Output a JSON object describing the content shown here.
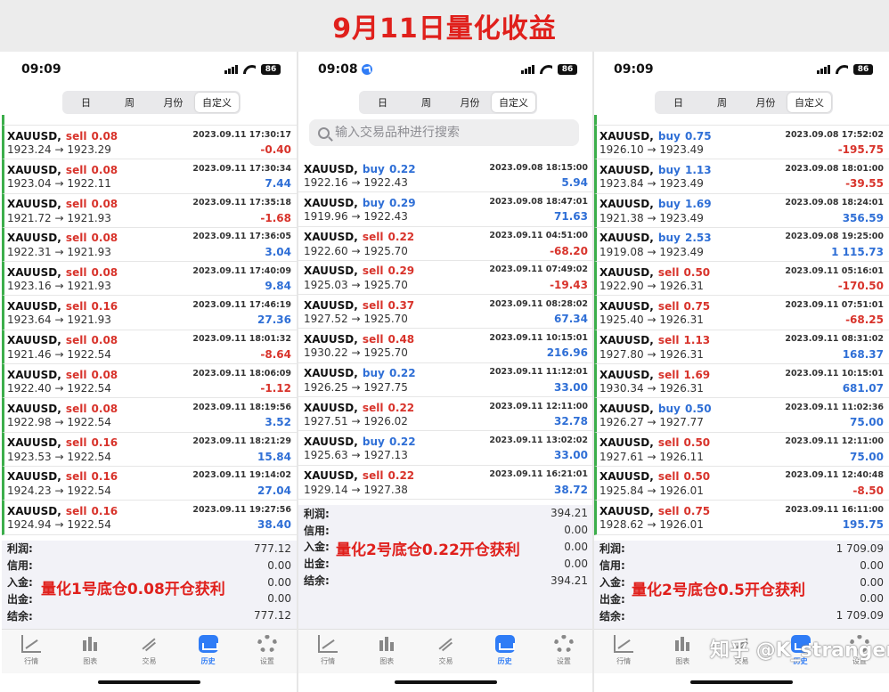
{
  "title": "9月11日量化收益",
  "status_bar": {
    "battery": "86"
  },
  "period_tabs": [
    "日",
    "周",
    "月份",
    "自定义"
  ],
  "active_tab": "自定义",
  "search_placeholder": "输入交易品种进行搜索",
  "nav": [
    "行情",
    "图表",
    "交易",
    "历史",
    "设置"
  ],
  "summary_labels": [
    "利润:",
    "信用:",
    "入金:",
    "出金:",
    "结余:"
  ],
  "watermark": "知乎 @K_stranger",
  "panels": [
    {
      "time": "09:09",
      "annotation": "量化1号底仓0.08开仓获利",
      "trades": [
        {
          "symbol": "XAUUSD,",
          "dir": "sell",
          "lot": "0.08",
          "datetime": "2023.09.11 17:30:17",
          "open": "1923.24",
          "close": "1923.29",
          "profit": "-0.40"
        },
        {
          "symbol": "XAUUSD,",
          "dir": "sell",
          "lot": "0.08",
          "datetime": "2023.09.11 17:30:34",
          "open": "1923.04",
          "close": "1922.11",
          "profit": "7.44"
        },
        {
          "symbol": "XAUUSD,",
          "dir": "sell",
          "lot": "0.08",
          "datetime": "2023.09.11 17:35:18",
          "open": "1921.72",
          "close": "1921.93",
          "profit": "-1.68"
        },
        {
          "symbol": "XAUUSD,",
          "dir": "sell",
          "lot": "0.08",
          "datetime": "2023.09.11 17:36:05",
          "open": "1922.31",
          "close": "1921.93",
          "profit": "3.04"
        },
        {
          "symbol": "XAUUSD,",
          "dir": "sell",
          "lot": "0.08",
          "datetime": "2023.09.11 17:40:09",
          "open": "1923.16",
          "close": "1921.93",
          "profit": "9.84"
        },
        {
          "symbol": "XAUUSD,",
          "dir": "sell",
          "lot": "0.16",
          "datetime": "2023.09.11 17:46:19",
          "open": "1923.64",
          "close": "1921.93",
          "profit": "27.36"
        },
        {
          "symbol": "XAUUSD,",
          "dir": "sell",
          "lot": "0.08",
          "datetime": "2023.09.11 18:01:32",
          "open": "1921.46",
          "close": "1922.54",
          "profit": "-8.64"
        },
        {
          "symbol": "XAUUSD,",
          "dir": "sell",
          "lot": "0.08",
          "datetime": "2023.09.11 18:06:09",
          "open": "1922.40",
          "close": "1922.54",
          "profit": "-1.12"
        },
        {
          "symbol": "XAUUSD,",
          "dir": "sell",
          "lot": "0.08",
          "datetime": "2023.09.11 18:19:56",
          "open": "1922.98",
          "close": "1922.54",
          "profit": "3.52"
        },
        {
          "symbol": "XAUUSD,",
          "dir": "sell",
          "lot": "0.16",
          "datetime": "2023.09.11 18:21:29",
          "open": "1923.53",
          "close": "1922.54",
          "profit": "15.84"
        },
        {
          "symbol": "XAUUSD,",
          "dir": "sell",
          "lot": "0.16",
          "datetime": "2023.09.11 19:14:02",
          "open": "1924.23",
          "close": "1922.54",
          "profit": "27.04"
        },
        {
          "symbol": "XAUUSD,",
          "dir": "sell",
          "lot": "0.16",
          "datetime": "2023.09.11 19:27:56",
          "open": "1924.94",
          "close": "1922.54",
          "profit": "38.40"
        }
      ],
      "summary": [
        "777.12",
        "0.00",
        "0.00",
        "0.00",
        "777.12"
      ]
    },
    {
      "time": "09:08",
      "annotation": "量化2号底仓0.22开仓获利",
      "trades": [
        {
          "symbol": "XAUUSD,",
          "dir": "buy",
          "lot": "0.22",
          "datetime": "2023.09.08 18:15:00",
          "open": "1922.16",
          "close": "1922.43",
          "profit": "5.94"
        },
        {
          "symbol": "XAUUSD,",
          "dir": "buy",
          "lot": "0.29",
          "datetime": "2023.09.08 18:47:01",
          "open": "1919.96",
          "close": "1922.43",
          "profit": "71.63"
        },
        {
          "symbol": "XAUUSD,",
          "dir": "sell",
          "lot": "0.22",
          "datetime": "2023.09.11 04:51:00",
          "open": "1922.60",
          "close": "1925.70",
          "profit": "-68.20"
        },
        {
          "symbol": "XAUUSD,",
          "dir": "sell",
          "lot": "0.29",
          "datetime": "2023.09.11 07:49:02",
          "open": "1925.03",
          "close": "1925.70",
          "profit": "-19.43"
        },
        {
          "symbol": "XAUUSD,",
          "dir": "sell",
          "lot": "0.37",
          "datetime": "2023.09.11 08:28:02",
          "open": "1927.52",
          "close": "1925.70",
          "profit": "67.34"
        },
        {
          "symbol": "XAUUSD,",
          "dir": "sell",
          "lot": "0.48",
          "datetime": "2023.09.11 10:15:01",
          "open": "1930.22",
          "close": "1925.70",
          "profit": "216.96"
        },
        {
          "symbol": "XAUUSD,",
          "dir": "buy",
          "lot": "0.22",
          "datetime": "2023.09.11 11:12:01",
          "open": "1926.25",
          "close": "1927.75",
          "profit": "33.00"
        },
        {
          "symbol": "XAUUSD,",
          "dir": "sell",
          "lot": "0.22",
          "datetime": "2023.09.11 12:11:00",
          "open": "1927.51",
          "close": "1926.02",
          "profit": "32.78"
        },
        {
          "symbol": "XAUUSD,",
          "dir": "buy",
          "lot": "0.22",
          "datetime": "2023.09.11 13:02:02",
          "open": "1925.63",
          "close": "1927.13",
          "profit": "33.00"
        },
        {
          "symbol": "XAUUSD,",
          "dir": "sell",
          "lot": "0.22",
          "datetime": "2023.09.11 16:21:01",
          "open": "1929.14",
          "close": "1927.38",
          "profit": "38.72"
        }
      ],
      "summary": [
        "394.21",
        "0.00",
        "0.00",
        "0.00",
        "394.21"
      ]
    },
    {
      "time": "09:09",
      "annotation": "量化2号底仓0.5开仓获利",
      "trades": [
        {
          "symbol": "XAUUSD,",
          "dir": "buy",
          "lot": "0.75",
          "datetime": "2023.09.08 17:52:02",
          "open": "1926.10",
          "close": "1923.49",
          "profit": "-195.75"
        },
        {
          "symbol": "XAUUSD,",
          "dir": "buy",
          "lot": "1.13",
          "datetime": "2023.09.08 18:01:00",
          "open": "1923.84",
          "close": "1923.49",
          "profit": "-39.55"
        },
        {
          "symbol": "XAUUSD,",
          "dir": "buy",
          "lot": "1.69",
          "datetime": "2023.09.08 18:24:01",
          "open": "1921.38",
          "close": "1923.49",
          "profit": "356.59"
        },
        {
          "symbol": "XAUUSD,",
          "dir": "buy",
          "lot": "2.53",
          "datetime": "2023.09.08 19:25:00",
          "open": "1919.08",
          "close": "1923.49",
          "profit": "1 115.73"
        },
        {
          "symbol": "XAUUSD,",
          "dir": "sell",
          "lot": "0.50",
          "datetime": "2023.09.11 05:16:01",
          "open": "1922.90",
          "close": "1926.31",
          "profit": "-170.50"
        },
        {
          "symbol": "XAUUSD,",
          "dir": "sell",
          "lot": "0.75",
          "datetime": "2023.09.11 07:51:01",
          "open": "1925.40",
          "close": "1926.31",
          "profit": "-68.25"
        },
        {
          "symbol": "XAUUSD,",
          "dir": "sell",
          "lot": "1.13",
          "datetime": "2023.09.11 08:31:02",
          "open": "1927.80",
          "close": "1926.31",
          "profit": "168.37"
        },
        {
          "symbol": "XAUUSD,",
          "dir": "sell",
          "lot": "1.69",
          "datetime": "2023.09.11 10:15:01",
          "open": "1930.34",
          "close": "1926.31",
          "profit": "681.07"
        },
        {
          "symbol": "XAUUSD,",
          "dir": "buy",
          "lot": "0.50",
          "datetime": "2023.09.11 11:02:36",
          "open": "1926.27",
          "close": "1927.77",
          "profit": "75.00"
        },
        {
          "symbol": "XAUUSD,",
          "dir": "sell",
          "lot": "0.50",
          "datetime": "2023.09.11 12:11:00",
          "open": "1927.61",
          "close": "1926.11",
          "profit": "75.00"
        },
        {
          "symbol": "XAUUSD,",
          "dir": "sell",
          "lot": "0.50",
          "datetime": "2023.09.11 12:40:48",
          "open": "1925.84",
          "close": "1926.01",
          "profit": "-8.50"
        },
        {
          "symbol": "XAUUSD,",
          "dir": "sell",
          "lot": "0.75",
          "datetime": "2023.09.11 16:11:00",
          "open": "1928.62",
          "close": "1926.01",
          "profit": "195.75"
        }
      ],
      "summary": [
        "1 709.09",
        "0.00",
        "0.00",
        "0.00",
        "1 709.09"
      ]
    }
  ]
}
